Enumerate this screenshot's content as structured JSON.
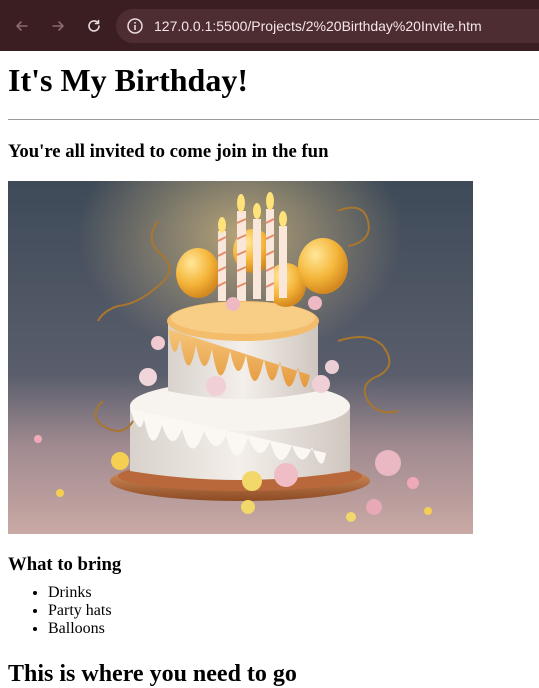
{
  "browser": {
    "url": "127.0.0.1:5500/Projects/2%20Birthday%20Invite.htm",
    "back_icon": "arrow-left-icon",
    "forward_icon": "arrow-right-icon",
    "reload_icon": "reload-icon",
    "site_info_icon": "info-icon"
  },
  "page": {
    "title": "It's My Birthday!",
    "subtitle": "You're all invited to come join in the fun",
    "image_alt": "Birthday cake with candles and balloons",
    "bring_heading": "What to bring",
    "bring_items": [
      "Drinks",
      "Party hats",
      "Balloons"
    ],
    "where_heading": "This is where you need to go"
  }
}
